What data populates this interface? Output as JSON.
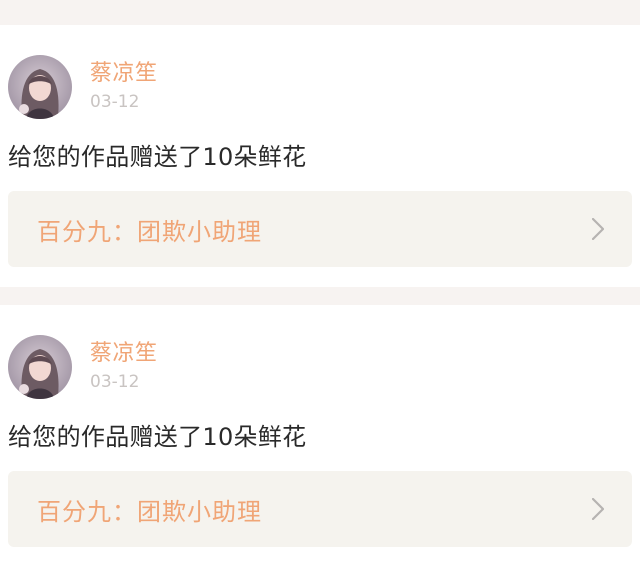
{
  "feed": {
    "items": [
      {
        "user": {
          "name": "蔡凉笙",
          "avatar_icon": "user-avatar-photo"
        },
        "date": "03-12",
        "message": "给您的作品赠送了10朵鲜花",
        "work": {
          "title": "百分九：团欺小助理",
          "chevron_icon": "chevron-right-icon"
        }
      },
      {
        "user": {
          "name": "蔡凉笙",
          "avatar_icon": "user-avatar-photo"
        },
        "date": "03-12",
        "message": "给您的作品赠送了10朵鲜花",
        "work": {
          "title": "百分九：团欺小助理",
          "chevron_icon": "chevron-right-icon"
        }
      }
    ]
  },
  "colors": {
    "accent": "#f0a576",
    "muted": "#c9c4c2",
    "text": "#2a2a2a",
    "page_bg": "#f7f3f1",
    "card_bg": "#ffffff",
    "link_bg": "#f5f3ee"
  }
}
